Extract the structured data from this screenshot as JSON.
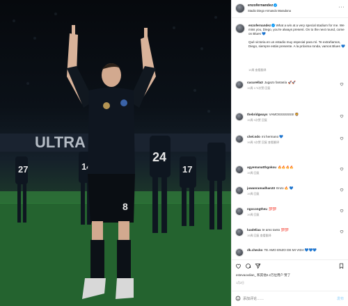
{
  "post": {
    "username": "enzofernandez",
    "location": "Stadio Diego Armando Maradona",
    "more_icon": "more-horizontal-icon"
  },
  "photo": {
    "banner_text": "ULTRA",
    "player_number": "8",
    "bg_numbers": [
      "27",
      "24",
      "17",
      "14"
    ],
    "accent": "#1f5a2c"
  },
  "caption": {
    "username": "enzofernandez",
    "text_en": "What a win at a very special stadium for me. We miss you, Diego, you're always present. On to the next round, come on Blues 💙",
    "text_es": "Qué victoria en un estadio muy especial para mí. Te extrañamos, Diego, siempre estás presente. A la próxima ronda, vamos Blues 💙",
    "meta": "19周    查看翻译"
  },
  "comments": [
    {
      "user": "cucurella3",
      "text": "Jugazo fantasía 🚀🚀",
      "meta": "19周   173次赞   回复"
    },
    {
      "user": "thebridgways",
      "text": "VAMOSSSSSSS! 🦁",
      "meta": "19周   9次赞   回复"
    },
    {
      "user": "chel.ndo",
      "text": "mi hermano 💙",
      "meta": "19周   3次赞   回复   查看翻译"
    },
    {
      "user": "agyemanatthgokou",
      "text": "🔥🔥🔥🔥",
      "meta": "19周   回复"
    },
    {
      "user": "juwanramadhan33",
      "text": "Enzo 🔥 💙",
      "meta": "19周   回复"
    },
    {
      "user": "ngocongtheu",
      "text": "💯💯",
      "meta": "19周   回复"
    },
    {
      "user": "luadeliaa",
      "text": "te amo tanto 💯💯",
      "meta": "19周   回复   查看翻译"
    },
    {
      "user": "dk.checko",
      "text": "TE AMO ENZO DE MI VIDA 💙💙💙",
      "meta": ""
    }
  ],
  "actions": {
    "icons": [
      "heart-icon",
      "comment-icon",
      "share-icon",
      "bookmark-icon"
    ]
  },
  "likes": {
    "text": "estevaovdian_ 和其他2.2万位用户 赞了"
  },
  "date": "1月2日",
  "add_comment": {
    "placeholder": "添加评论……",
    "post_label": "发布"
  }
}
